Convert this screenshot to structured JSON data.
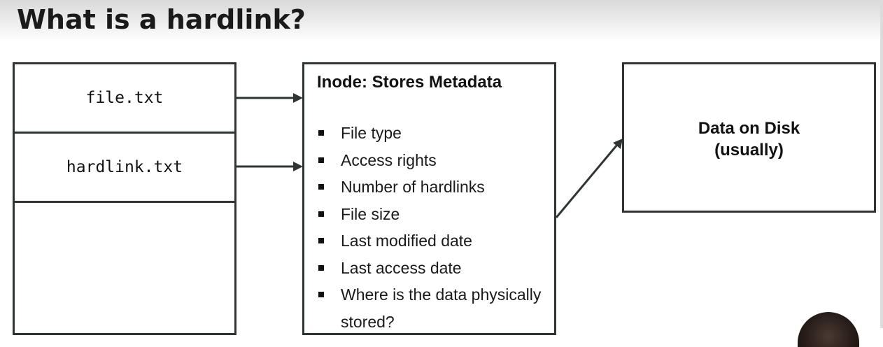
{
  "slide": {
    "title": "What is a hardlink?"
  },
  "directory": {
    "entries": [
      "file.txt",
      "hardlink.txt"
    ]
  },
  "inode": {
    "title": "Inode: Stores Metadata",
    "items": [
      "File type",
      "Access rights",
      "Number of hardlinks",
      "File size",
      "Last modified date",
      "Last access date",
      "Where is the data physically stored?"
    ]
  },
  "disk": {
    "label_line1": "Data on Disk",
    "label_line2": "(usually)"
  },
  "colors": {
    "stroke": "#2f3535",
    "text": "#141414",
    "background": "#ffffff"
  }
}
